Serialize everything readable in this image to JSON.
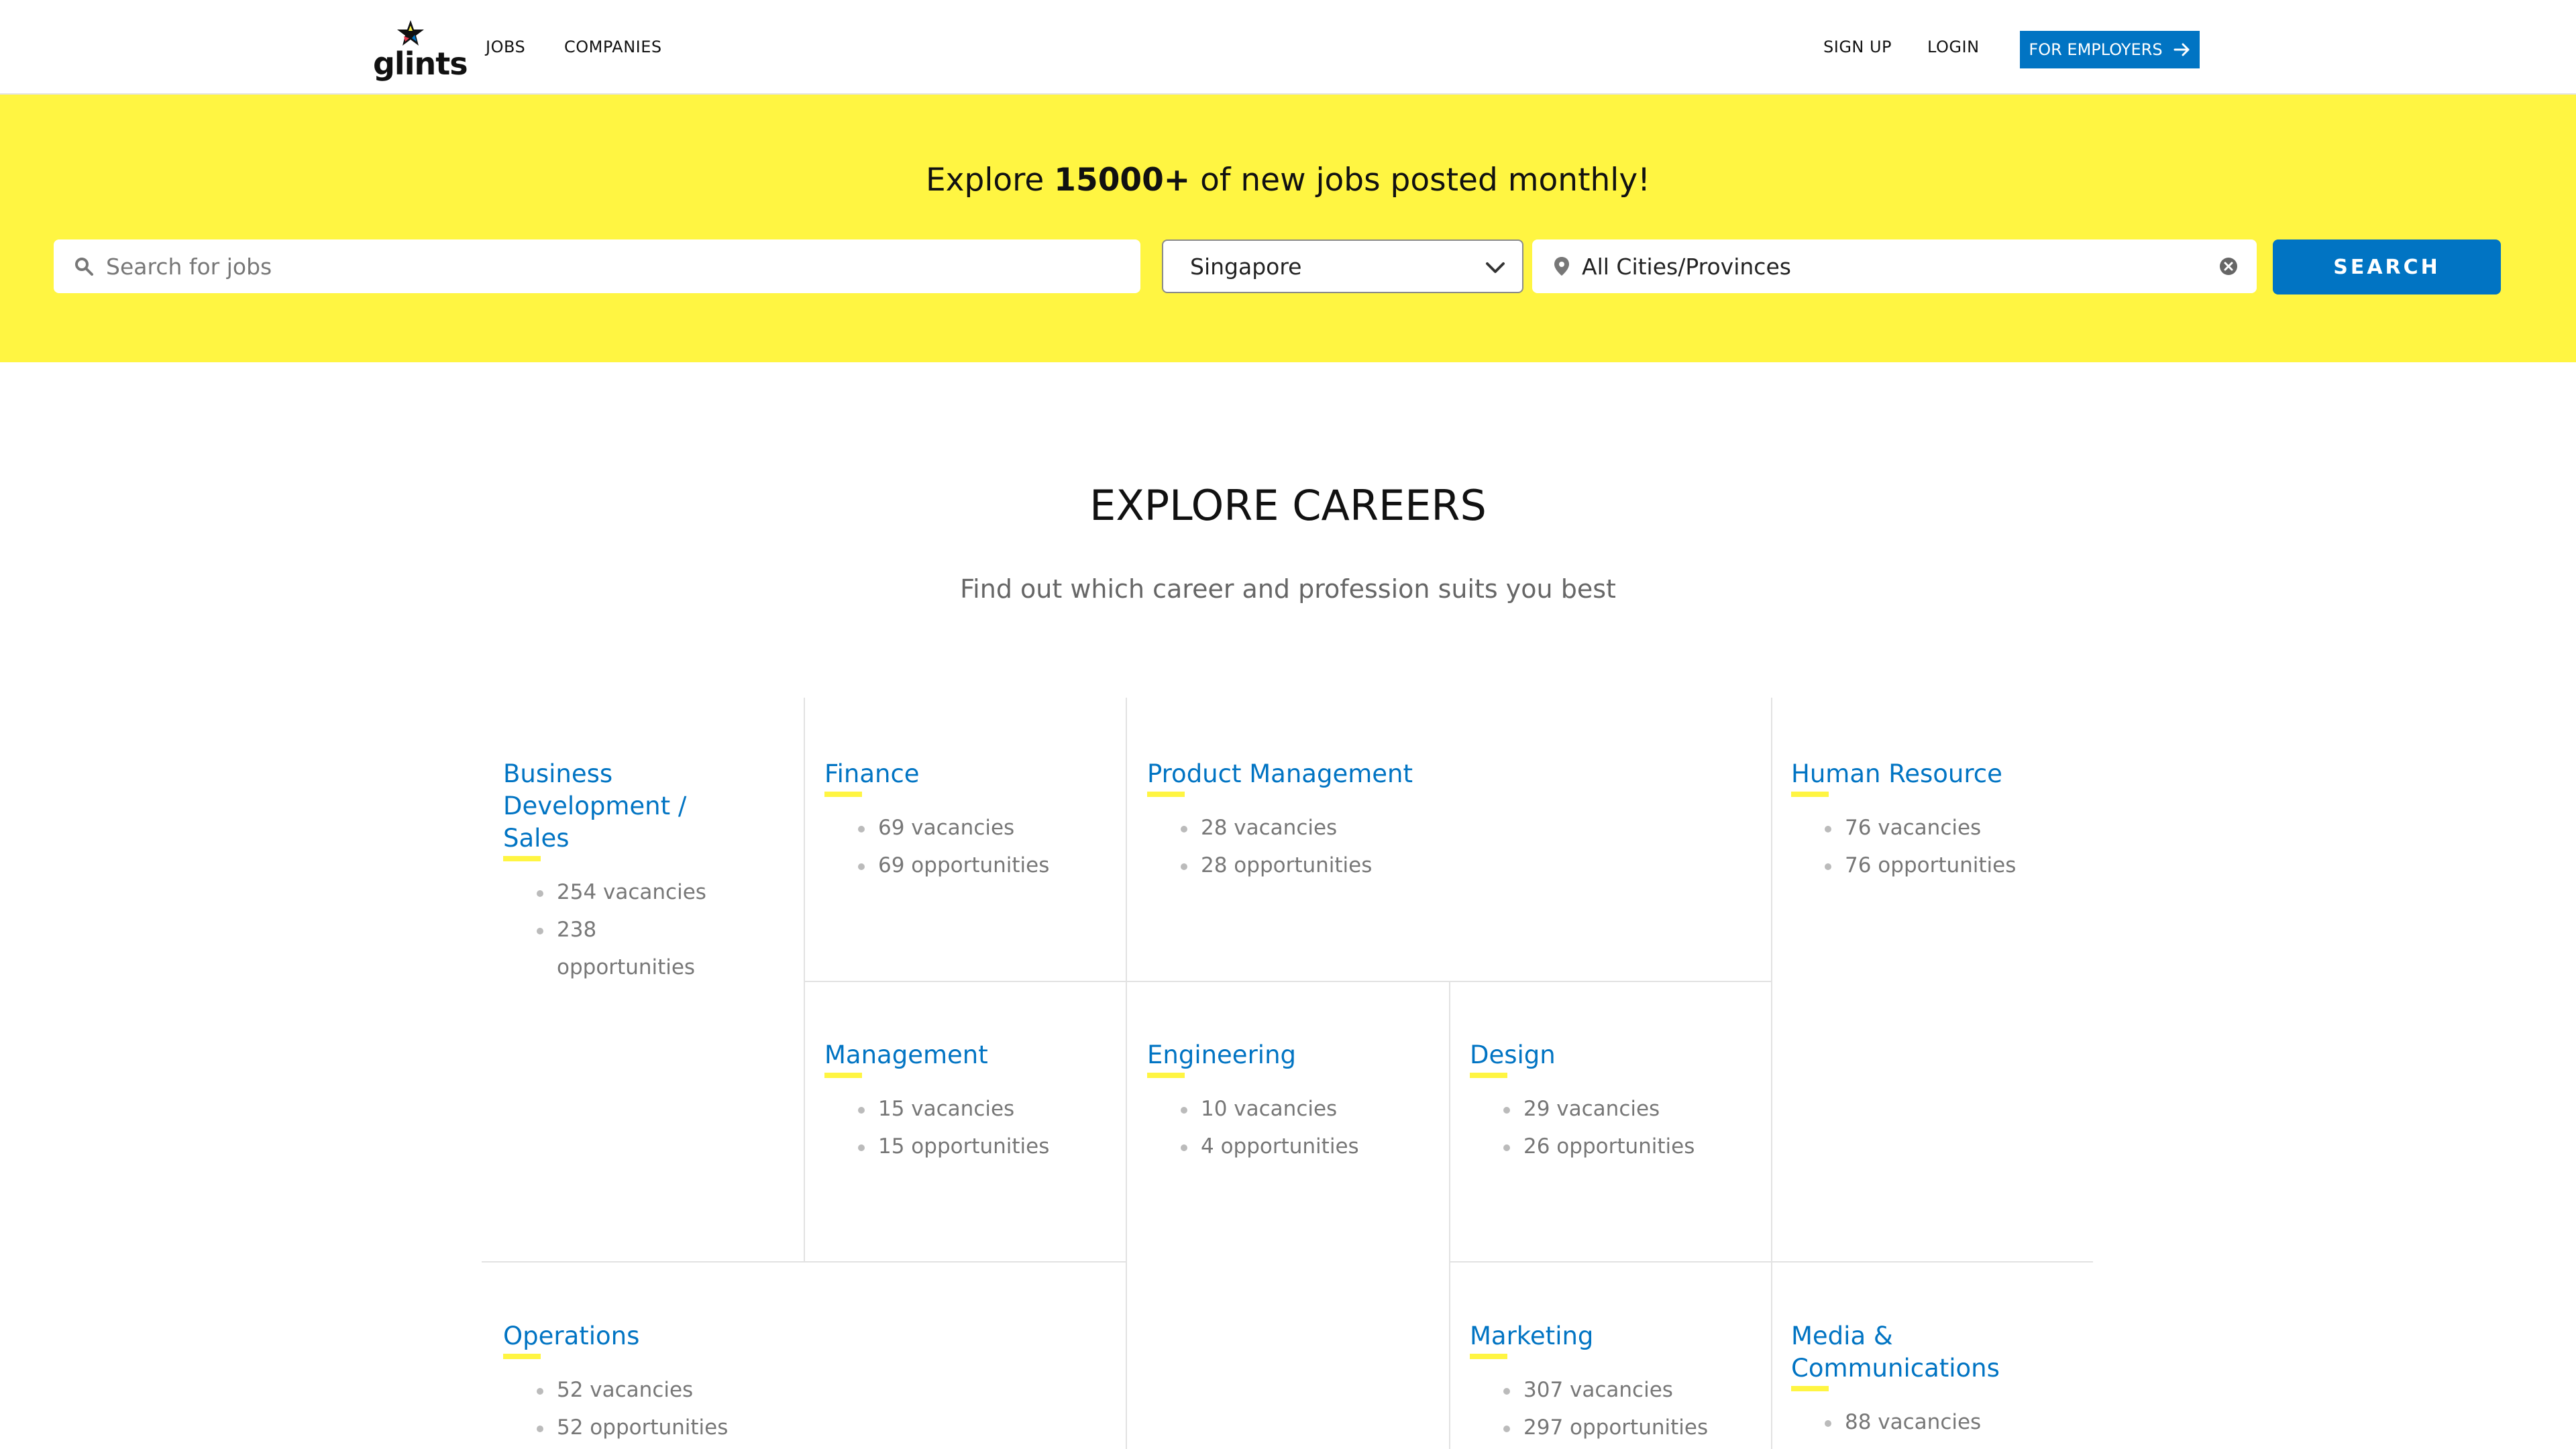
{
  "nav": {
    "logo_text": "glints",
    "links": [
      "JOBS",
      "COMPANIES"
    ],
    "signup": "SIGN UP",
    "login": "LOGIN",
    "employers": "FOR EMPLOYERS",
    "accent_color": "#0174c3"
  },
  "hero": {
    "title_pre": "Explore ",
    "title_bold": "15000+",
    "title_post": " of new jobs posted monthly!",
    "search_placeholder": "Search for jobs",
    "country": "Singapore",
    "city": "All Cities/Provinces",
    "search_button": "SEARCH",
    "background_color": "#fff542"
  },
  "explore": {
    "title": "EXPLORE CAREERS",
    "subtitle": "Find out which career and profession suits you best"
  },
  "careers": [
    {
      "name": "Business Development / Sales",
      "vacancies": "254 vacancies",
      "opportunities": "238 opportunities"
    },
    {
      "name": "Finance",
      "vacancies": "69 vacancies",
      "opportunities": "69 opportunities"
    },
    {
      "name": "Product Management",
      "vacancies": "28 vacancies",
      "opportunities": "28 opportunities"
    },
    {
      "name": "Human Resource",
      "vacancies": "76 vacancies",
      "opportunities": "76 opportunities"
    },
    {
      "name": "Management",
      "vacancies": "15 vacancies",
      "opportunities": "15 opportunities"
    },
    {
      "name": "Engineering",
      "vacancies": "10 vacancies",
      "opportunities": "4 opportunities"
    },
    {
      "name": "Design",
      "vacancies": "29 vacancies",
      "opportunities": "26 opportunities"
    },
    {
      "name": "Operations",
      "vacancies": "52 vacancies",
      "opportunities": "52 opportunities"
    },
    {
      "name": "Marketing",
      "vacancies": "307 vacancies",
      "opportunities": "297 opportunities"
    },
    {
      "name": "Media & Communications",
      "vacancies": "88 vacancies"
    }
  ]
}
